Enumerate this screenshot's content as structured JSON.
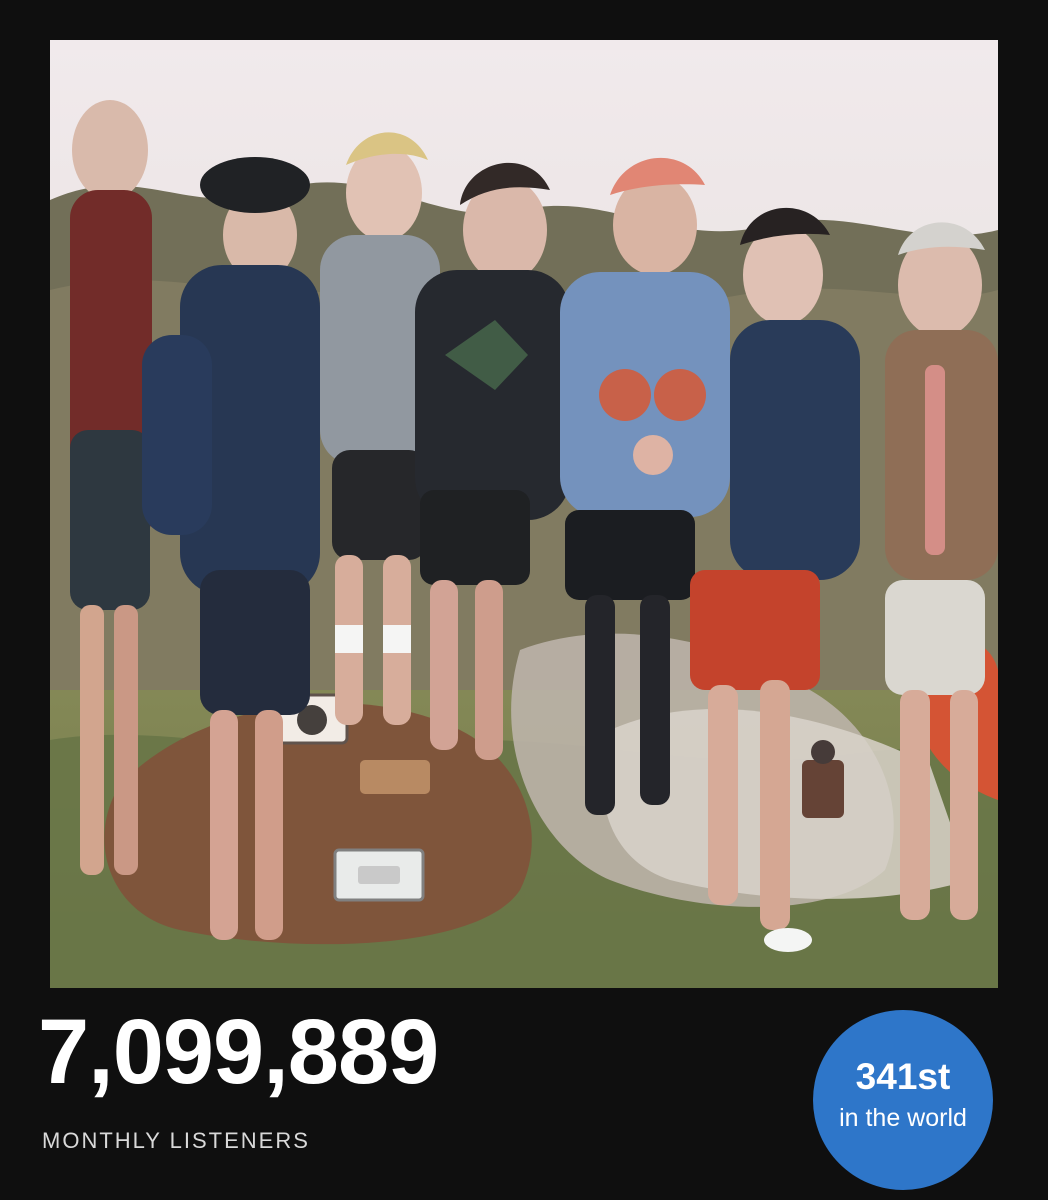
{
  "image": {
    "alt": "Group photo of seven people posing outdoors on a grassy hill with picnic props"
  },
  "stats": {
    "monthly_listeners_value": "7,099,889",
    "monthly_listeners_label": "MONTHLY LISTENERS",
    "rank_value": "341st",
    "rank_caption": "in the world"
  },
  "colors": {
    "background": "#0f0f0f",
    "badge": "#2e76c9",
    "label": "#d9d9d9"
  }
}
